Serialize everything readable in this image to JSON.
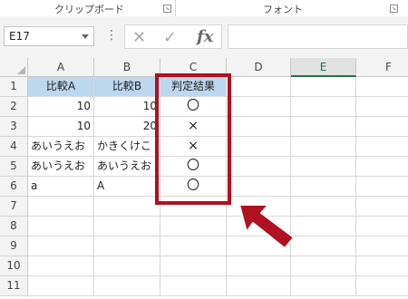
{
  "ribbon": {
    "group1_label": "クリップボード",
    "group2_label": "フォント",
    "launcher_symbol": "↘"
  },
  "formula_bar": {
    "name_box": "E17",
    "dots": "⋮",
    "cancel_symbol": "✕",
    "enter_symbol": "✓",
    "function_symbol": "fx",
    "formula_value": ""
  },
  "sheet": {
    "columns": [
      "A",
      "B",
      "C",
      "D",
      "E",
      "F"
    ],
    "selected_column": "E",
    "rows": [
      "1",
      "2",
      "3",
      "4",
      "5",
      "6",
      "7",
      "8",
      "9",
      "10",
      "11"
    ],
    "header_fill_color": "#bdd7ee",
    "cells": {
      "A1": "比較A",
      "B1": "比較B",
      "C1": "判定結果",
      "A2": "10",
      "B2": "10",
      "C2": "〇",
      "A3": "10",
      "B3": "20",
      "C3": "×",
      "A4": "あいうえお",
      "B4": "かきくけこ",
      "C4": "×",
      "A5": "あいうえお",
      "B5": "あいうえお",
      "C5": "〇",
      "A6": "a",
      "B6": "A",
      "C6": "〇"
    }
  },
  "annotation": {
    "highlight_color": "#b01020",
    "arrow_color": "#b01020",
    "arrow_icon": "arrow-pointing-up-left"
  }
}
